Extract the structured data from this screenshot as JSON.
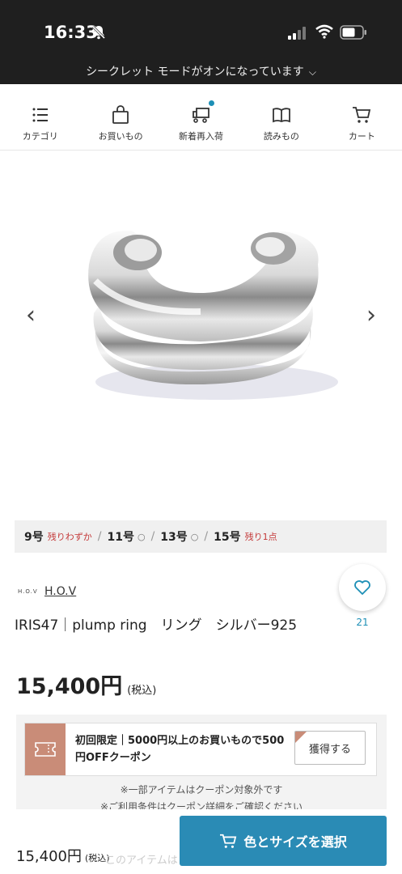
{
  "status": {
    "time": "16:33",
    "icons": [
      "bell-slash-icon",
      "signal-icon",
      "wifi-icon",
      "battery-icon"
    ],
    "secret_mode": "シークレット モードがオンになっています"
  },
  "nav": {
    "items": [
      {
        "label": "カテゴリ",
        "icon": "list-icon"
      },
      {
        "label": "お買いもの",
        "icon": "bag-icon"
      },
      {
        "label": "新着再入荷",
        "icon": "truck-icon",
        "has_dot": true
      },
      {
        "label": "読みもの",
        "icon": "book-icon"
      },
      {
        "label": "カート",
        "icon": "cart-icon"
      }
    ],
    "accent_color": "#1d8fb6"
  },
  "sizes": [
    {
      "size": "9号",
      "stock": "残りわずか"
    },
    {
      "size": "11号",
      "stock": "○"
    },
    {
      "size": "13号",
      "stock": "○"
    },
    {
      "size": "15号",
      "stock": "残り1点"
    }
  ],
  "product": {
    "brand_logo": "H.O.V",
    "brand_name": "H.O.V",
    "title": "IRIS47｜plump ring　リング　シルバー925",
    "price": "15,400円",
    "tax_label": "(税込)",
    "favorite_count": "21"
  },
  "coupon": {
    "text": "初回限定｜5000円以上のお買いもので500円OFFクーポン",
    "button": "獲得する",
    "note1": "※一部アイテムはクーポン対象外です",
    "note2": "※ご利用条件はクーポン詳細をご確認ください"
  },
  "bottom": {
    "price": "15,400円",
    "tax_label": "(税込)",
    "ghost_text": "このアイテムは",
    "select_button": "色とサイズを選択",
    "button_color": "#2a8bb5"
  }
}
